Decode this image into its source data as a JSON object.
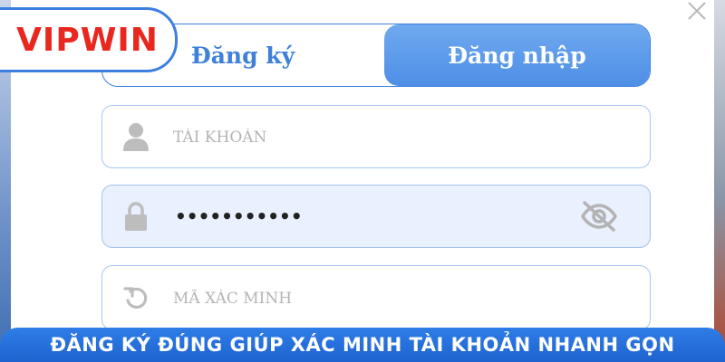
{
  "brand": {
    "logo_text": "VIPWIN",
    "colors": {
      "accent": "#3c7fe0",
      "logo_red": "#e8281f",
      "banner": "#2169d8"
    }
  },
  "dialog": {
    "close_icon": "close-icon",
    "tabs": [
      {
        "label": "Đăng ký",
        "active": false
      },
      {
        "label": "Đăng nhập",
        "active": true
      }
    ],
    "fields": {
      "username": {
        "placeholder": "TÀI KHOẢN",
        "value": "",
        "icon": "user-icon"
      },
      "password": {
        "value_masked": "•••••••••••",
        "icon": "lock-icon",
        "toggle_icon": "eye-off-icon"
      },
      "captcha": {
        "placeholder": "MÃ XÁC MINH",
        "value": "",
        "icon": "refresh-icon"
      }
    }
  },
  "banner": {
    "text": "ĐĂNG KÝ ĐÚNG GIÚP XÁC MINH TÀI KHOẢN NHANH GỌN"
  }
}
